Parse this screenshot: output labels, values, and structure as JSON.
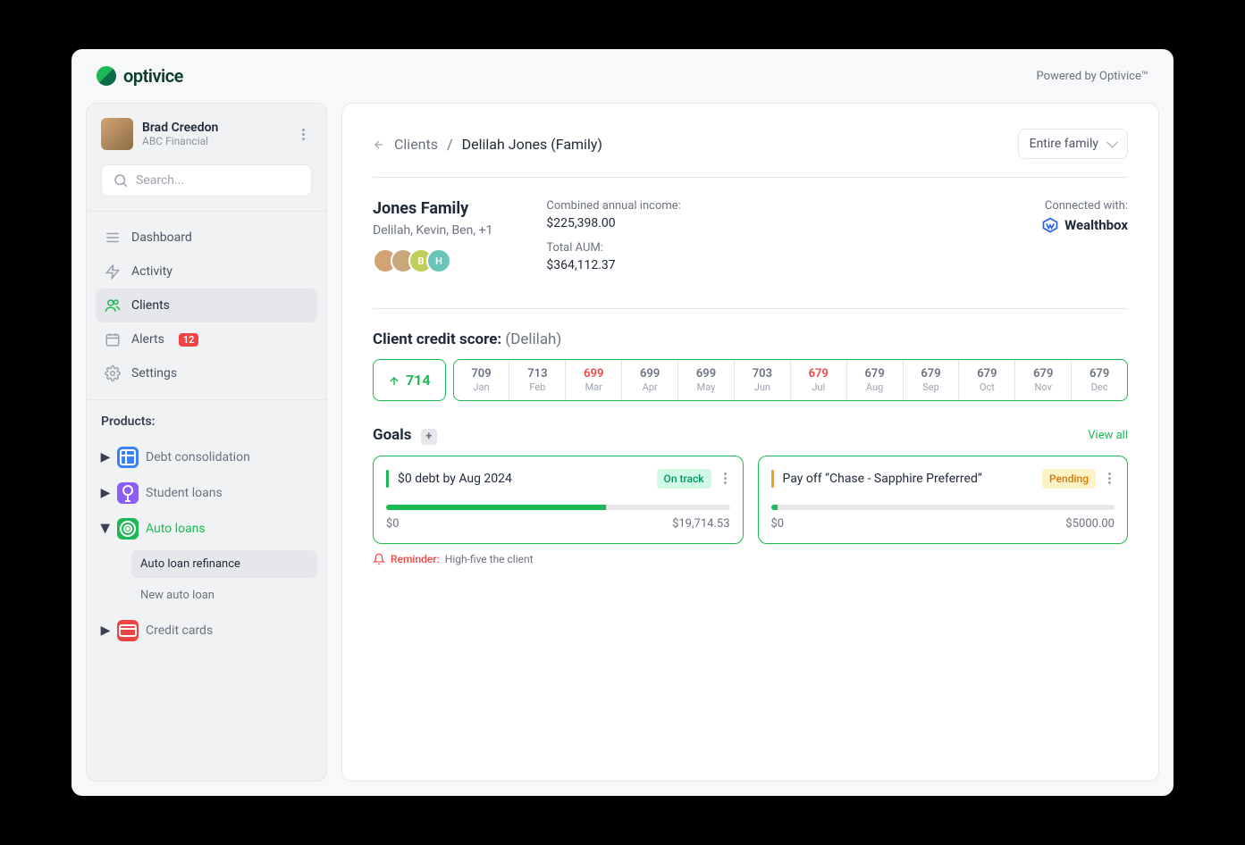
{
  "brand": {
    "name": "optivice",
    "powered": "Powered by Optivice™"
  },
  "user": {
    "name": "Brad Creedon",
    "org": "ABC Financial"
  },
  "search": {
    "placeholder": "Search..."
  },
  "nav": {
    "dashboard": "Dashboard",
    "activity": "Activity",
    "clients": "Clients",
    "alerts": "Alerts",
    "alerts_badge": "12",
    "settings": "Settings"
  },
  "products": {
    "title": "Products:",
    "items": {
      "debt": "Debt consolidation",
      "student": "Student loans",
      "auto": "Auto loans",
      "credit": "Credit cards"
    },
    "auto_sub": {
      "refinance": "Auto loan refinance",
      "new": "New auto loan"
    }
  },
  "colors": {
    "debt": "#3B82F6",
    "student": "#8B5CF6",
    "auto": "#1DB954",
    "credit": "#EF4444"
  },
  "breadcrumb": {
    "back": "Clients",
    "current": "Delilah Jones (Family)"
  },
  "filter": {
    "selected": "Entire family"
  },
  "family": {
    "title": "Jones Family",
    "members": "Delilah, Kevin, Ben, +1",
    "income_label": "Combined annual income:",
    "income": "$225,398.00",
    "aum_label": "Total AUM:",
    "aum": "$364,112.37",
    "connected_label": "Connected with:",
    "connected_name": "Wealthbox",
    "avatars": [
      "#D4A373",
      "#C9A77A",
      "#BFCF5A",
      "#6AC5B8"
    ],
    "avatar_letters": [
      "",
      "",
      "B",
      "H"
    ]
  },
  "credit": {
    "title": "Client credit score:",
    "who": "(Delilah)",
    "current": "714",
    "months": [
      {
        "v": "709",
        "m": "Jan",
        "red": false
      },
      {
        "v": "713",
        "m": "Feb",
        "red": false
      },
      {
        "v": "699",
        "m": "Mar",
        "red": true
      },
      {
        "v": "699",
        "m": "Apr",
        "red": false
      },
      {
        "v": "699",
        "m": "May",
        "red": false
      },
      {
        "v": "703",
        "m": "Jun",
        "red": false
      },
      {
        "v": "679",
        "m": "Jul",
        "red": true
      },
      {
        "v": "679",
        "m": "Aug",
        "red": false
      },
      {
        "v": "679",
        "m": "Sep",
        "red": false
      },
      {
        "v": "679",
        "m": "Oct",
        "red": false
      },
      {
        "v": "679",
        "m": "Nov",
        "red": false
      },
      {
        "v": "679",
        "m": "Dec",
        "red": false
      }
    ]
  },
  "goals": {
    "title": "Goals",
    "view_all": "View all",
    "list": [
      {
        "name": "$0 debt by Aug 2024",
        "status": "On track",
        "status_type": "green",
        "low": "$0",
        "high": "$19,714.53",
        "progress": 64
      },
      {
        "name": "Pay off “Chase - Sapphire Preferred”",
        "status": "Pending",
        "status_type": "orange",
        "low": "$0",
        "high": "$5000.00",
        "progress": 2
      }
    ],
    "reminder_label": "Reminder:",
    "reminder_text": "High-five the client"
  }
}
